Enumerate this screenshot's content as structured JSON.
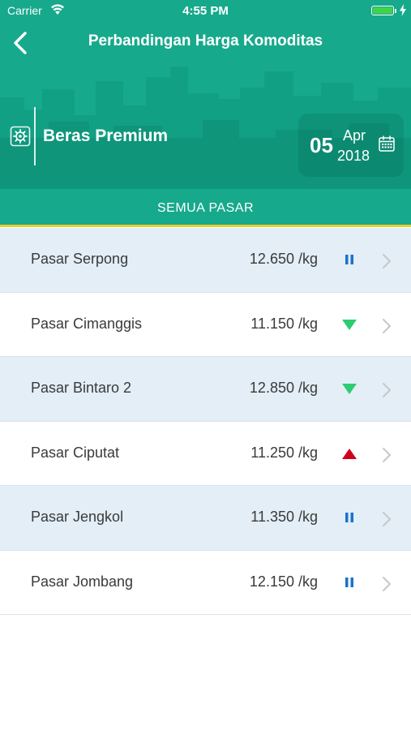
{
  "status_bar": {
    "carrier": "Carrier",
    "time": "4:55 PM"
  },
  "nav": {
    "title": "Perbandingan Harga Komoditas",
    "back_icon": "chevron-left-icon"
  },
  "commodity": {
    "name": "Beras Premium",
    "icon": "gear-icon"
  },
  "date": {
    "day": "05",
    "month": "Apr",
    "year": "2018",
    "icon": "calendar-icon"
  },
  "tab": {
    "label": "SEMUA PASAR"
  },
  "colors": {
    "primary": "#17a98c",
    "accent_underline": "#e9cf2e",
    "trend_down": "#2ecc71",
    "trend_up": "#d0021b",
    "trend_flat": "#1a73c9",
    "row_alt": "#e3eef7"
  },
  "markets": [
    {
      "name": "Pasar Serpong",
      "price": "12.650 /kg",
      "trend": "flat"
    },
    {
      "name": "Pasar Cimanggis",
      "price": "11.150 /kg",
      "trend": "down"
    },
    {
      "name": "Pasar Bintaro 2",
      "price": "12.850 /kg",
      "trend": "down"
    },
    {
      "name": "Pasar Ciputat",
      "price": "11.250 /kg",
      "trend": "up"
    },
    {
      "name": "Pasar Jengkol",
      "price": "11.350 /kg",
      "trend": "flat"
    },
    {
      "name": "Pasar Jombang",
      "price": "12.150 /kg",
      "trend": "flat"
    }
  ]
}
